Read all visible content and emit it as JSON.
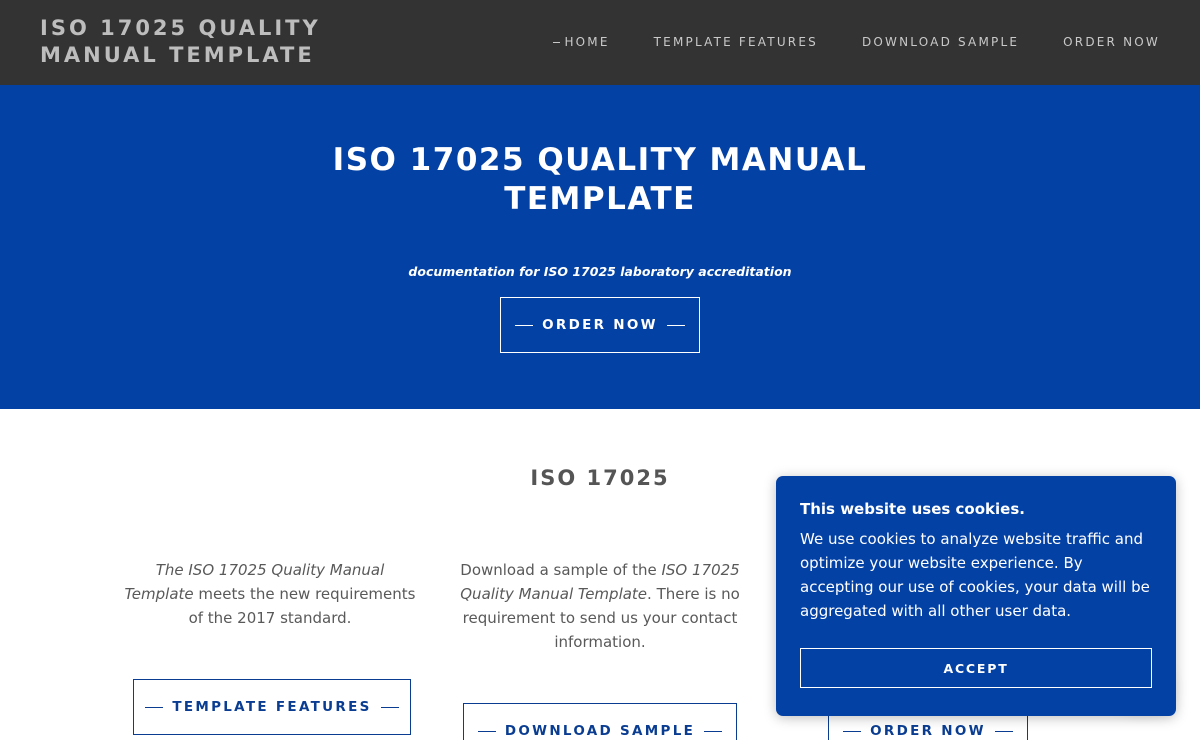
{
  "header": {
    "brand": "ISO 17025 QUALITY MANUAL TEMPLATE",
    "nav": [
      {
        "label": "HOME",
        "active": true
      },
      {
        "label": "TEMPLATE FEATURES"
      },
      {
        "label": "DOWNLOAD SAMPLE"
      },
      {
        "label": "ORDER NOW"
      }
    ]
  },
  "hero": {
    "title": "ISO 17025 QUALITY MANUAL TEMPLATE",
    "subtitle": "documentation for ISO 17025 laboratory accreditation",
    "button": "ORDER NOW"
  },
  "content": {
    "section_title": "ISO 17025",
    "col1": {
      "em": "The ISO 17025 Quality Manual Template",
      "rest": " meets the new requirements of the 2017 standard.",
      "button": "TEMPLATE FEATURES"
    },
    "col2": {
      "pre": "Download a sample of the ",
      "em": "ISO 17025 Quality Manual Template",
      "rest": ". There is no requirement to send us your contact information.",
      "button": "DOWNLOAD SAMPLE"
    },
    "col3": {
      "button": "ORDER NOW"
    }
  },
  "cookie": {
    "title": "This website uses cookies.",
    "body": "We use cookies to analyze website traffic and optimize your website experience. By accepting our use of cookies, your data will be aggregated with all other user data.",
    "accept": "ACCEPT"
  },
  "colors": {
    "header_bg": "#333333",
    "hero_bg": "#0441a5",
    "accent": "#0a3d91"
  }
}
